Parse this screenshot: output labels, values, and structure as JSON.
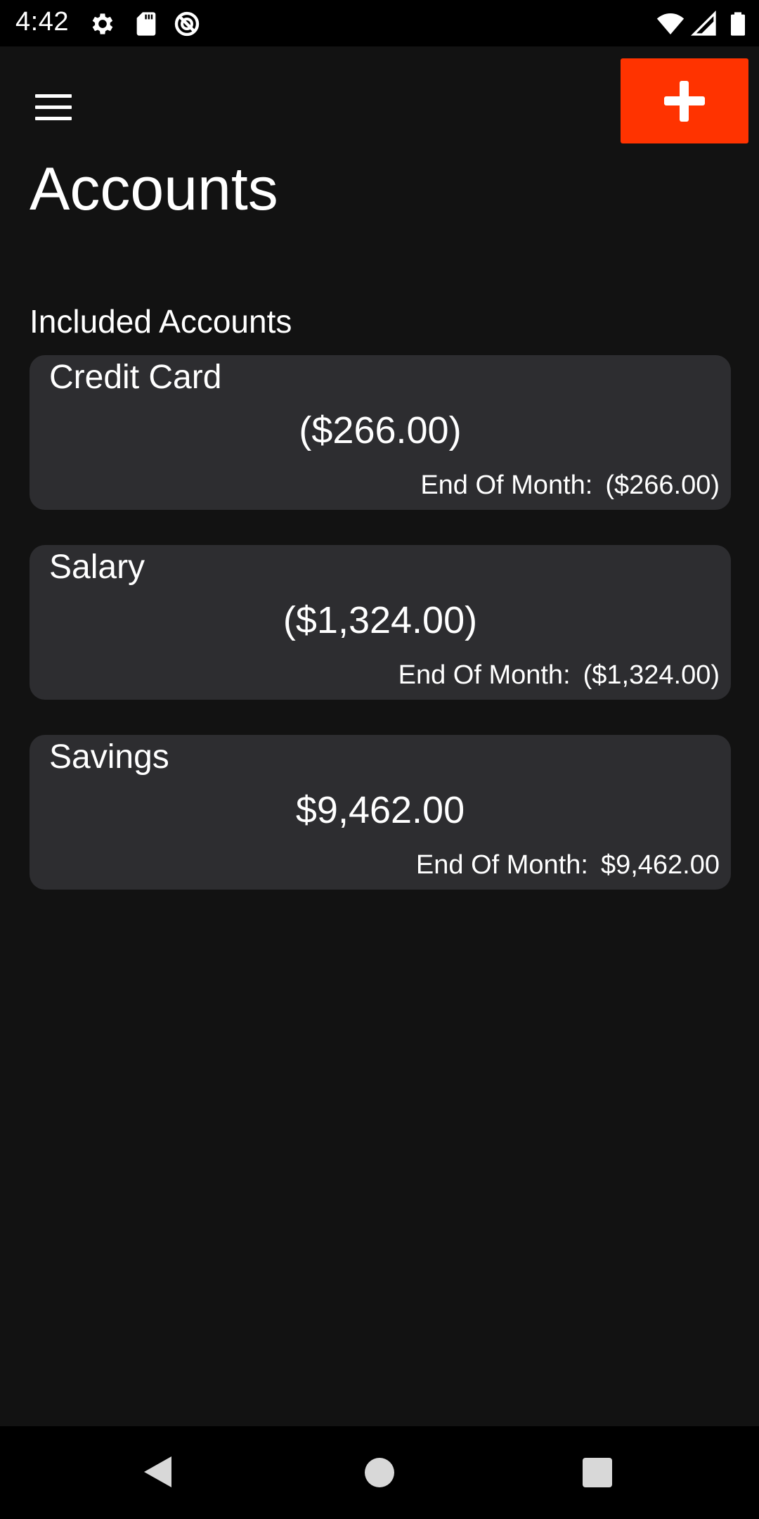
{
  "status_bar": {
    "time": "4:42",
    "icons": [
      "gear-icon",
      "sd-card-icon",
      "data-saver-icon",
      "wifi-icon",
      "cell-signal-icon",
      "battery-icon"
    ]
  },
  "header": {
    "menu_icon": "hamburger-menu-icon",
    "add_icon": "plus-icon",
    "accent_color": "#ff3300"
  },
  "page": {
    "title": "Accounts",
    "section_label": "Included Accounts"
  },
  "accounts": [
    {
      "name": "Credit Card",
      "balance": "($266.00)",
      "eom_label": "End Of Month:",
      "eom_value": "($266.00)"
    },
    {
      "name": "Salary",
      "balance": "($1,324.00)",
      "eom_label": "End Of Month:",
      "eom_value": "($1,324.00)"
    },
    {
      "name": "Savings",
      "balance": "$9,462.00",
      "eom_label": "End Of Month:",
      "eom_value": "$9,462.00"
    }
  ],
  "nav_bar": {
    "icons": [
      "back-icon",
      "home-icon",
      "recents-icon"
    ]
  }
}
